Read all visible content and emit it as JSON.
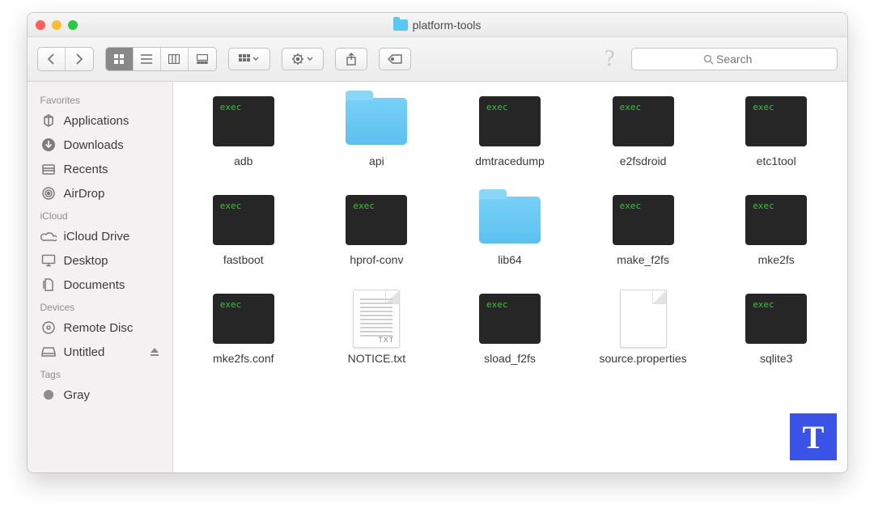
{
  "window": {
    "title": "platform-tools"
  },
  "search": {
    "placeholder": "Search"
  },
  "sidebar": {
    "sections": [
      {
        "header": "Favorites",
        "items": [
          {
            "label": "Applications",
            "icon": "applications"
          },
          {
            "label": "Downloads",
            "icon": "downloads"
          },
          {
            "label": "Recents",
            "icon": "recents"
          },
          {
            "label": "AirDrop",
            "icon": "airdrop"
          }
        ]
      },
      {
        "header": "iCloud",
        "items": [
          {
            "label": "iCloud Drive",
            "icon": "cloud"
          },
          {
            "label": "Desktop",
            "icon": "desktop"
          },
          {
            "label": "Documents",
            "icon": "documents"
          }
        ]
      },
      {
        "header": "Devices",
        "items": [
          {
            "label": "Remote Disc",
            "icon": "disc"
          },
          {
            "label": "Untitled",
            "icon": "drive",
            "eject": true
          }
        ]
      },
      {
        "header": "Tags",
        "items": [
          {
            "label": "Gray",
            "icon": "dot-gray"
          }
        ]
      }
    ]
  },
  "files": [
    {
      "name": "adb",
      "type": "exec"
    },
    {
      "name": "api",
      "type": "folder"
    },
    {
      "name": "dmtracedump",
      "type": "exec"
    },
    {
      "name": "e2fsdroid",
      "type": "exec"
    },
    {
      "name": "etc1tool",
      "type": "exec"
    },
    {
      "name": "fastboot",
      "type": "exec"
    },
    {
      "name": "hprof-conv",
      "type": "exec"
    },
    {
      "name": "lib64",
      "type": "folder"
    },
    {
      "name": "make_f2fs",
      "type": "exec"
    },
    {
      "name": "mke2fs",
      "type": "exec"
    },
    {
      "name": "mke2fs.conf",
      "type": "exec"
    },
    {
      "name": "NOTICE.txt",
      "type": "txt"
    },
    {
      "name": "sload_f2fs",
      "type": "exec"
    },
    {
      "name": "source.properties",
      "type": "blank"
    },
    {
      "name": "sqlite3",
      "type": "exec"
    }
  ],
  "watermark": "T"
}
